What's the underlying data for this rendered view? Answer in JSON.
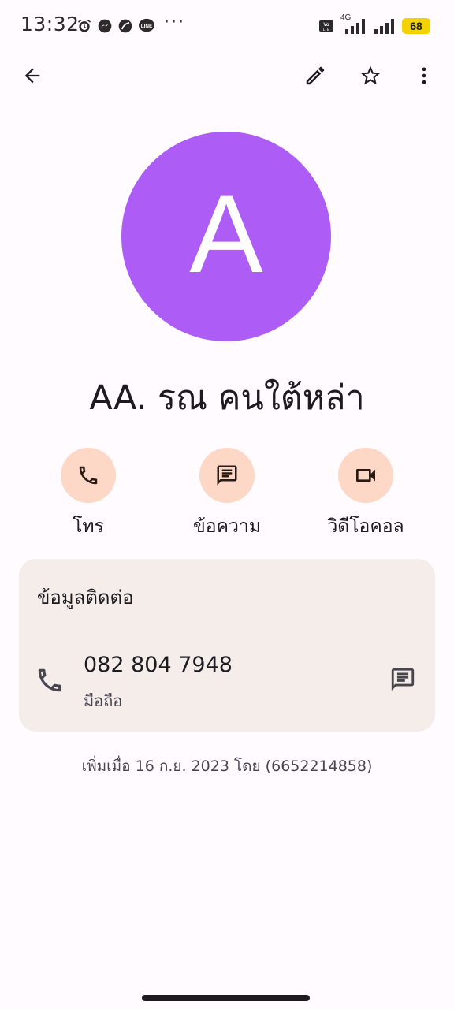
{
  "status_bar": {
    "time": "13:32",
    "dots": "···",
    "icons": [
      "alarm-icon",
      "messenger-icon",
      "leaf-icon",
      "line-icon"
    ],
    "network": "4G",
    "battery": "68"
  },
  "toolbar": {
    "back_icon": "arrow-left-icon",
    "edit_icon": "pencil-icon",
    "favorite_icon": "star-outline-icon",
    "more_icon": "more-vert-icon"
  },
  "contact": {
    "avatar_letter": "A",
    "avatar_color": "#ad5df5",
    "name": "AA. รณ คนใต้หล่า"
  },
  "actions": [
    {
      "label": "โทร",
      "icon": "phone-icon"
    },
    {
      "label": "ข้อความ",
      "icon": "message-icon"
    },
    {
      "label": "วิดีโอคอล",
      "icon": "videocam-icon"
    }
  ],
  "contact_info": {
    "title": "ข้อมูลติดต่อ",
    "phone_number": "082 804 7948",
    "phone_type": "มือถือ"
  },
  "footer": {
    "added_text": "เพิ่มเมื่อ 16 ก.ย. 2023 โดย (6652214858)"
  },
  "colors": {
    "background": "#fffbfe",
    "action_circle": "#fdd8c7",
    "card": "#f4ede9",
    "battery": "#f5d100"
  }
}
